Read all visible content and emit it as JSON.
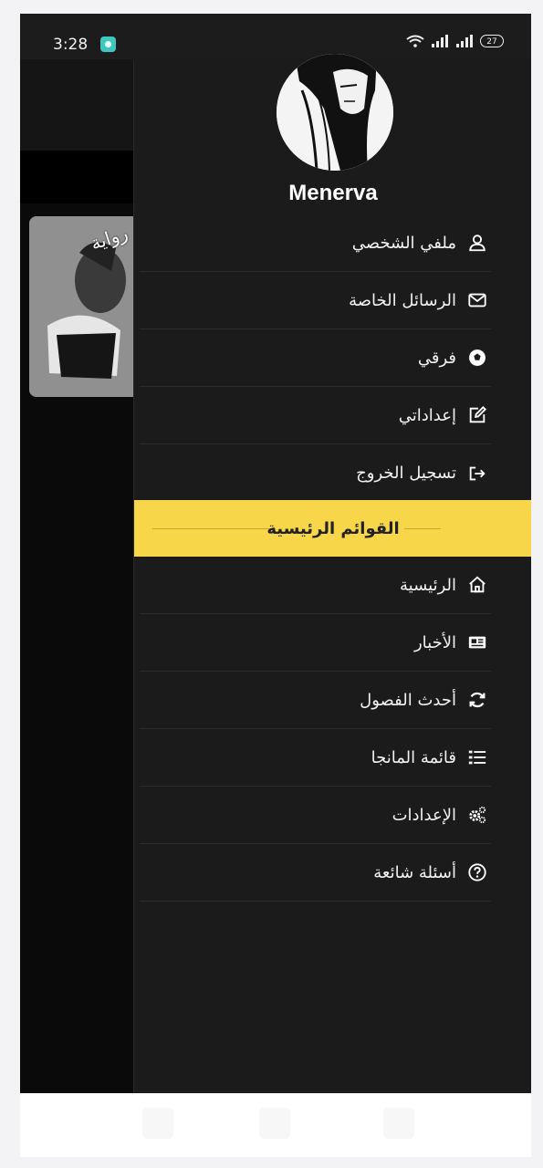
{
  "status_bar": {
    "time": "3:28",
    "battery": "27"
  },
  "background_app": {
    "cover_label": "رواية"
  },
  "drawer": {
    "username": "Menerva",
    "account_items": [
      {
        "label": "ملفي الشخصي",
        "icon": "user-icon"
      },
      {
        "label": "الرسائل الخاصة",
        "icon": "envelope-icon"
      },
      {
        "label": "فرقي",
        "icon": "soccer-ball-icon"
      },
      {
        "label": "إعداداتي",
        "icon": "edit-icon"
      },
      {
        "label": "تسجيل الخروج",
        "icon": "logout-icon"
      }
    ],
    "section_header": "القوائم الرئيسية",
    "main_items": [
      {
        "label": "الرئيسية",
        "icon": "home-icon"
      },
      {
        "label": "الأخبار",
        "icon": "newspaper-icon"
      },
      {
        "label": "أحدث الفصول",
        "icon": "refresh-icon"
      },
      {
        "label": "قائمة المانجا",
        "icon": "list-icon"
      },
      {
        "label": "الإعدادات",
        "icon": "gears-icon"
      },
      {
        "label": "أسئلة شائعة",
        "icon": "question-icon"
      }
    ]
  },
  "colors": {
    "drawer_bg": "#1b1b1b",
    "accent": "#f7d64a",
    "text": "#f2f2f2"
  }
}
